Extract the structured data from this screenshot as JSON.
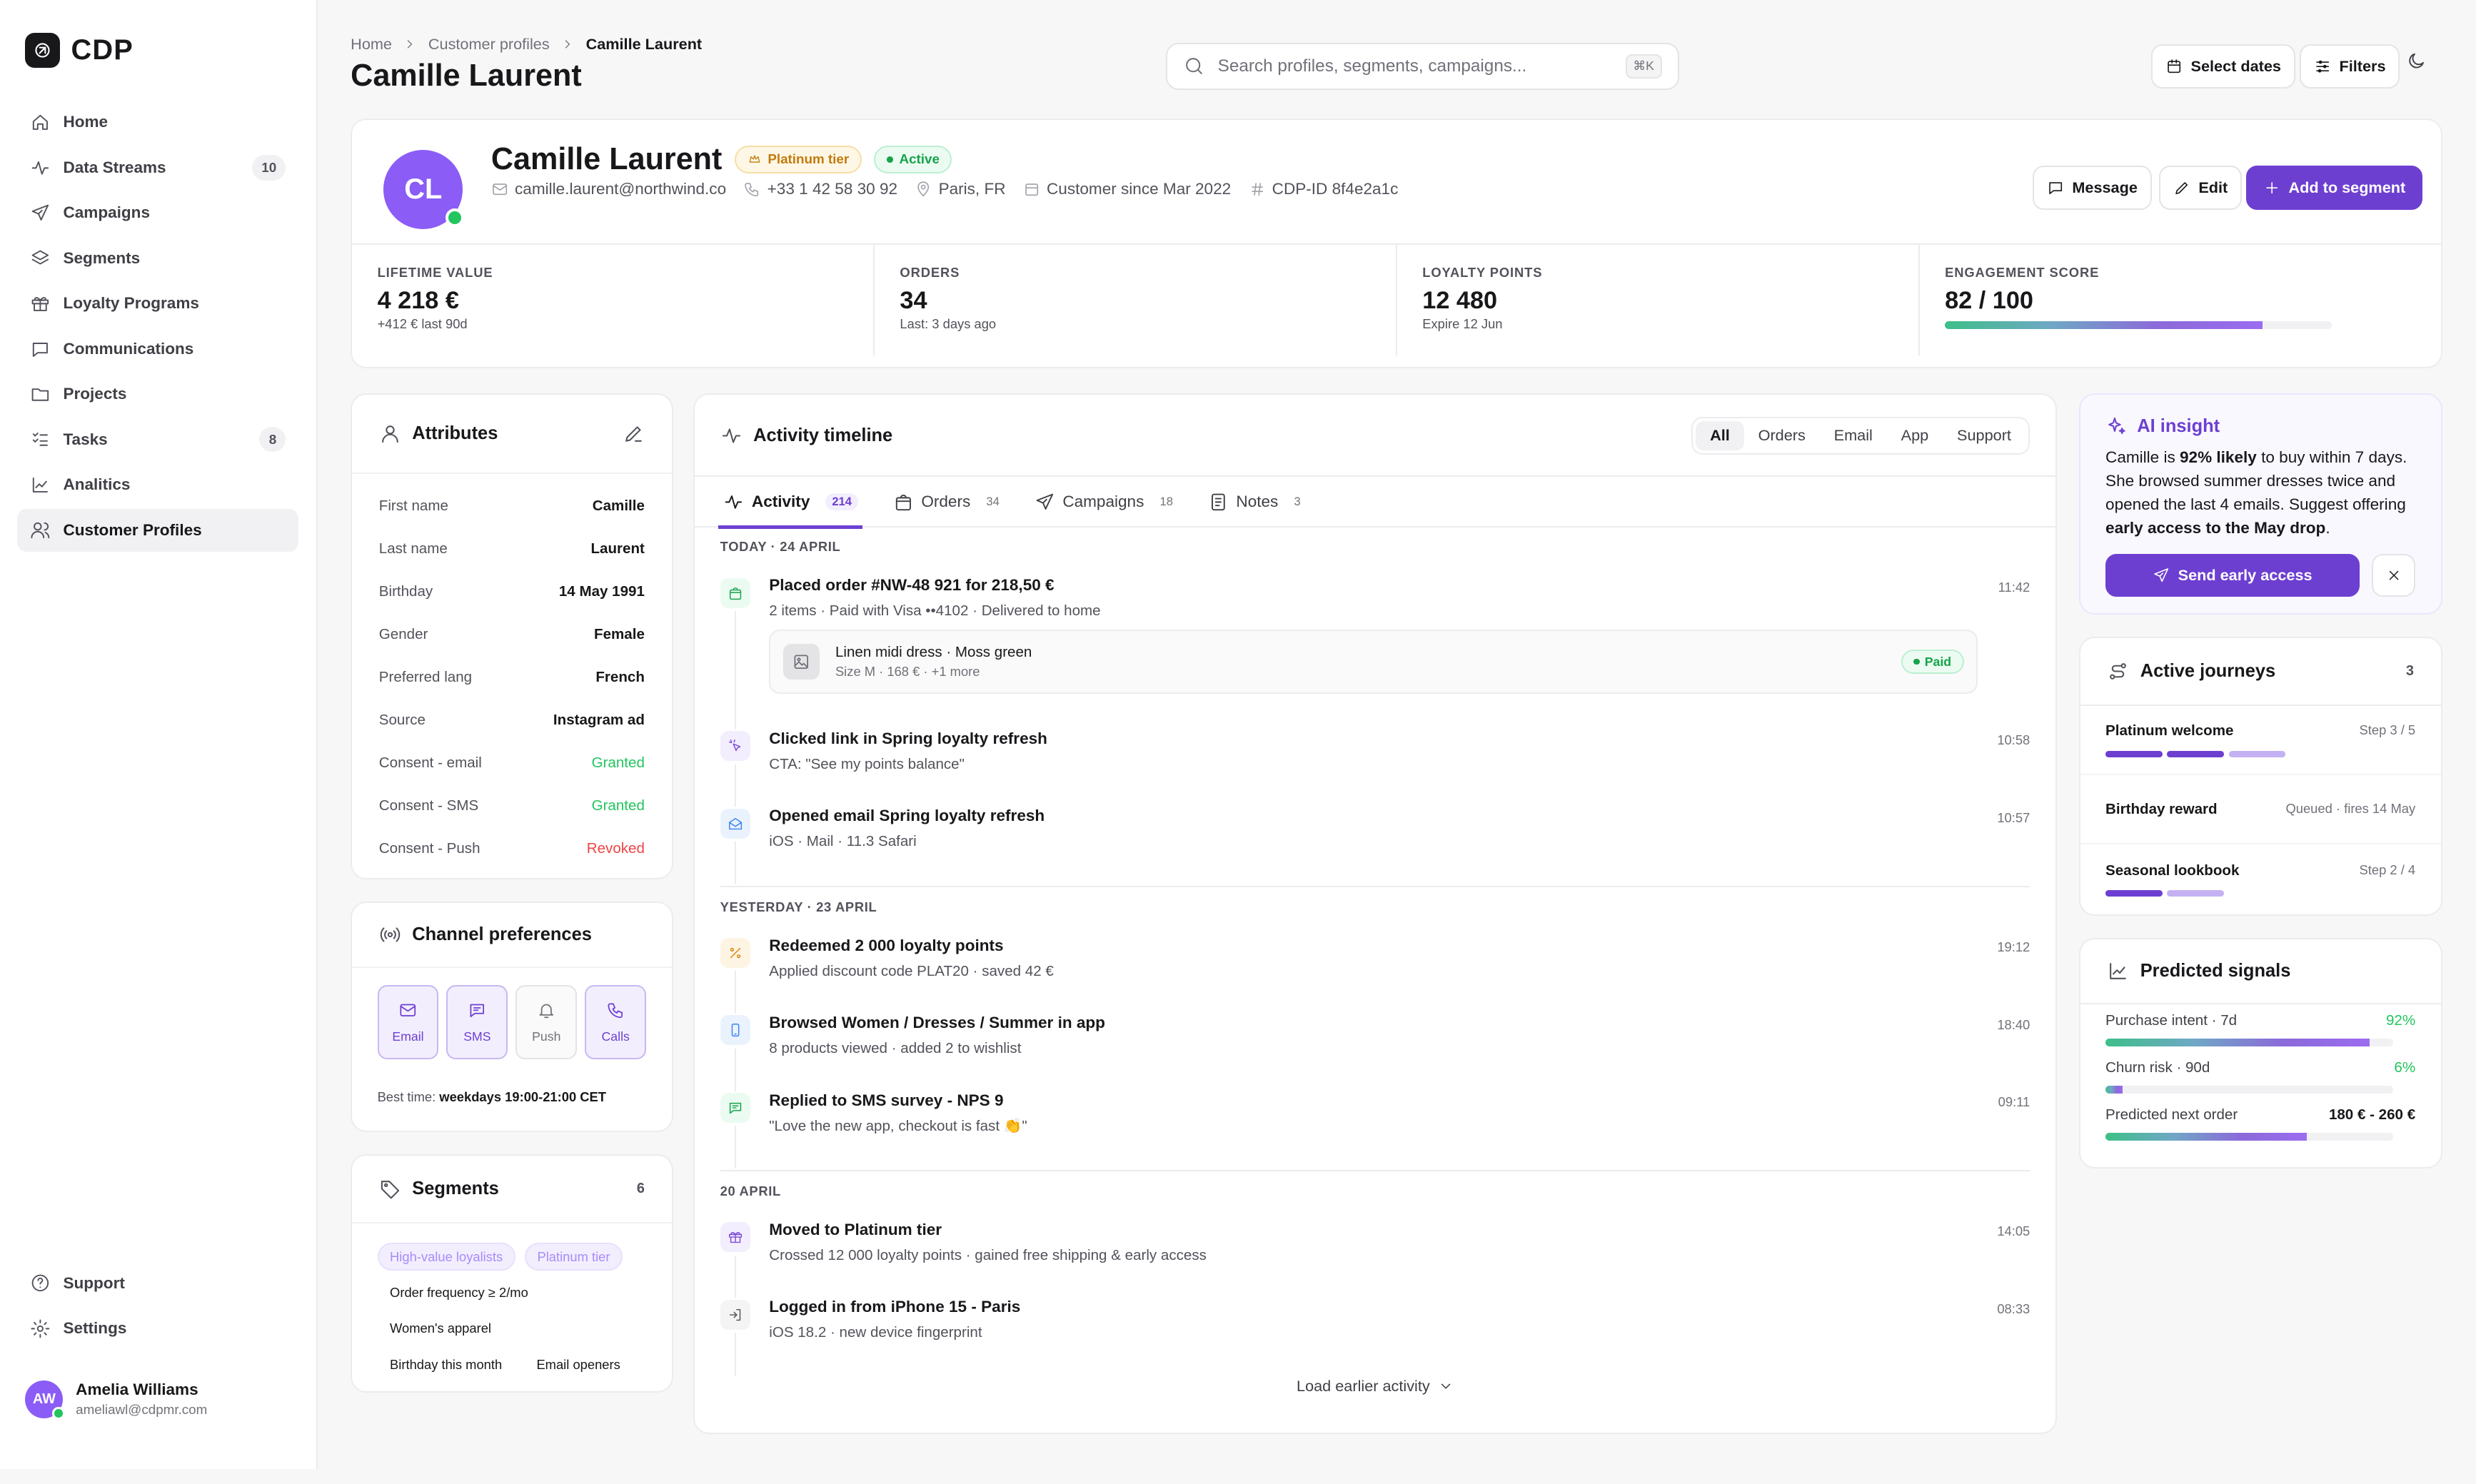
{
  "brand": {
    "name": "CDP"
  },
  "nav": [
    {
      "label": "Home",
      "icon": "home-icon"
    },
    {
      "label": "Data Streams",
      "icon": "activity-icon",
      "badge": "10"
    },
    {
      "label": "Campaigns",
      "icon": "send-icon"
    },
    {
      "label": "Segments",
      "icon": "layers-icon"
    },
    {
      "label": "Loyalty Programs",
      "icon": "gift-icon"
    },
    {
      "label": "Communications",
      "icon": "message-icon"
    },
    {
      "label": "Projects",
      "icon": "folder-icon"
    },
    {
      "label": "Tasks",
      "icon": "tasks-icon",
      "badge": "8"
    },
    {
      "label": "Analitics",
      "icon": "chart-icon"
    },
    {
      "label": "Customer Profiles",
      "icon": "users-icon",
      "active": true
    }
  ],
  "nav_bottom": [
    {
      "label": "Support",
      "icon": "help-icon"
    },
    {
      "label": "Settings",
      "icon": "gear-icon"
    }
  ],
  "user": {
    "initials": "AW",
    "name": "Amelia Williams",
    "email": "ameliawl@cdpmr.com"
  },
  "breadcrumb": [
    "Home",
    "Customer profiles",
    "Camille Laurent"
  ],
  "page_title": "Camille Laurent",
  "search": {
    "placeholder": "Search profiles, segments, campaigns...",
    "shortcut": "⌘K"
  },
  "header_buttons": {
    "dates": "Select dates",
    "filters": "Filters"
  },
  "profile": {
    "initials": "CL",
    "name": "Camille Laurent",
    "tier": "Platinum tier",
    "status": "Active",
    "email": "camille.laurent@northwind.co",
    "phone": "+33 1 42 58 30 92",
    "location": "Paris, FR",
    "since": "Customer since Mar 2022",
    "cdp_id": "CDP-ID 8f4e2a1c",
    "actions": {
      "message": "Message",
      "edit": "Edit",
      "add": "Add to segment"
    }
  },
  "kpis": [
    {
      "label": "LIFETIME VALUE",
      "value": "4 218 €",
      "sub": "+412 € last 90d"
    },
    {
      "label": "ORDERS",
      "value": "34",
      "sub": "Last: 3 days ago"
    },
    {
      "label": "LOYALTY POINTS",
      "value": "12 480",
      "sub": "Expire 12 Jun"
    },
    {
      "label": "ENGAGEMENT SCORE",
      "value": "82 / 100",
      "score": 82
    }
  ],
  "attributes": {
    "title": "Attributes",
    "rows": [
      {
        "k": "First name",
        "v": "Camille"
      },
      {
        "k": "Last name",
        "v": "Laurent"
      },
      {
        "k": "Birthday",
        "v": "14 May 1991"
      },
      {
        "k": "Gender",
        "v": "Female"
      },
      {
        "k": "Preferred lang",
        "v": "French"
      },
      {
        "k": "Source",
        "v": "Instagram ad"
      },
      {
        "k": "Consent - email",
        "v": "Granted",
        "state": "granted"
      },
      {
        "k": "Consent - SMS",
        "v": "Granted",
        "state": "granted"
      },
      {
        "k": "Consent - Push",
        "v": "Revoked",
        "state": "revoked"
      }
    ]
  },
  "channels": {
    "title": "Channel preferences",
    "options": [
      {
        "label": "Email",
        "icon": "mail-icon",
        "on": true
      },
      {
        "label": "SMS",
        "icon": "sms-icon",
        "on": true
      },
      {
        "label": "Push",
        "icon": "bell-icon",
        "on": false
      },
      {
        "label": "Calls",
        "icon": "phone-icon",
        "on": true
      }
    ],
    "best_label": "Best time:",
    "best_value": "weekdays 19:00-21:00 CET"
  },
  "segments": {
    "title": "Segments",
    "count": "6",
    "tags": [
      {
        "label": "High-value loyalists",
        "style": "pur"
      },
      {
        "label": "Platinum tier",
        "style": "pur"
      },
      {
        "label": "Order frequency ≥ 2/mo",
        "style": "plain"
      },
      {
        "label": "Women's apparel",
        "style": "plain"
      },
      {
        "label": "Birthday this month",
        "style": "plain"
      },
      {
        "label": "Email openers",
        "style": "plain"
      }
    ]
  },
  "timeline": {
    "title": "Activity timeline",
    "filters": [
      "All",
      "Orders",
      "Email",
      "App",
      "Support"
    ],
    "tabs": [
      {
        "label": "Activity",
        "count": "214",
        "icon": "activity-icon"
      },
      {
        "label": "Orders",
        "count": "34",
        "icon": "bag-icon"
      },
      {
        "label": "Campaigns",
        "count": "18",
        "icon": "send-icon"
      },
      {
        "label": "Notes",
        "count": "3",
        "icon": "note-icon"
      }
    ],
    "groups": [
      {
        "day": "TODAY · 24 APRIL",
        "events": [
          {
            "title": "Placed order #NW-48 921 for 218,50 €",
            "sub": "2 items · Paid with Visa ••4102 · Delivered to home",
            "time": "11:42",
            "icon": "bag-icon",
            "color": "green",
            "order": {
              "item": "Linen midi dress · Moss green",
              "detail": "Size M · 168 € · +1 more",
              "status": "Paid"
            }
          },
          {
            "title": "Clicked link in Spring loyalty refresh",
            "sub": "CTA: \"See my points balance\"",
            "time": "10:58",
            "icon": "click-icon",
            "color": "purple"
          },
          {
            "title": "Opened email Spring loyalty refresh",
            "sub": "iOS · Mail · 11.3 Safari",
            "time": "10:57",
            "icon": "mail-open-icon",
            "color": "blue"
          }
        ]
      },
      {
        "day": "YESTERDAY · 23 APRIL",
        "events": [
          {
            "title": "Redeemed 2 000 loyalty points",
            "sub": "Applied discount code PLAT20 · saved 42 €",
            "time": "19:12",
            "icon": "percent-icon",
            "color": "amber"
          },
          {
            "title": "Browsed Women / Dresses / Summer in app",
            "sub": "8 products viewed · added 2 to wishlist",
            "time": "18:40",
            "icon": "mobile-icon",
            "color": "blue"
          },
          {
            "title": "Replied to SMS survey - NPS 9",
            "sub": "\"Love the new app, checkout is fast 👏\"",
            "time": "09:11",
            "icon": "sms-icon",
            "color": "green"
          }
        ]
      },
      {
        "day": "20 APRIL",
        "events": [
          {
            "title": "Moved to Platinum tier",
            "sub": "Crossed 12 000 loyalty points · gained free shipping & early access",
            "time": "14:05",
            "icon": "gift-icon",
            "color": "purple"
          },
          {
            "title": "Logged in from iPhone 15 - Paris",
            "sub": "iOS 18.2 · new device fingerprint",
            "time": "08:33",
            "icon": "login-icon",
            "color": "gray"
          }
        ]
      }
    ],
    "load_more": "Load earlier activity"
  },
  "insight": {
    "title": "AI insight",
    "p1": "Camille is ",
    "b1": "92% likely",
    "p2": " to buy within 7 days. She browsed summer dresses twice and opened the last 4 emails. Suggest offering ",
    "b2": "early access to the May drop",
    "p3": ".",
    "action": "Send early access"
  },
  "journeys": {
    "title": "Active journeys",
    "count": "3",
    "items": [
      {
        "name": "Platinum welcome",
        "status": "Step 3 / 5",
        "steps": [
          "done",
          "done",
          "cur"
        ]
      },
      {
        "name": "Birthday reward",
        "status": "Queued · fires 14 May",
        "steps": []
      },
      {
        "name": "Seasonal lookbook",
        "status": "Step 2 / 4",
        "steps": [
          "done",
          "cur"
        ]
      }
    ]
  },
  "signals": {
    "title": "Predicted signals",
    "items": [
      {
        "label": "Purchase intent · 7d",
        "value": "92%",
        "level": 0.92
      },
      {
        "label": "Churn risk · 90d",
        "value": "6%",
        "level": 0.06
      },
      {
        "label": "Predicted next order",
        "value": "180 € - 260 €",
        "level": 0.7,
        "dark": true
      }
    ]
  },
  "colors": {
    "accent": "#6d3fd1",
    "success": "#22c55e",
    "danger": "#ef4444"
  }
}
